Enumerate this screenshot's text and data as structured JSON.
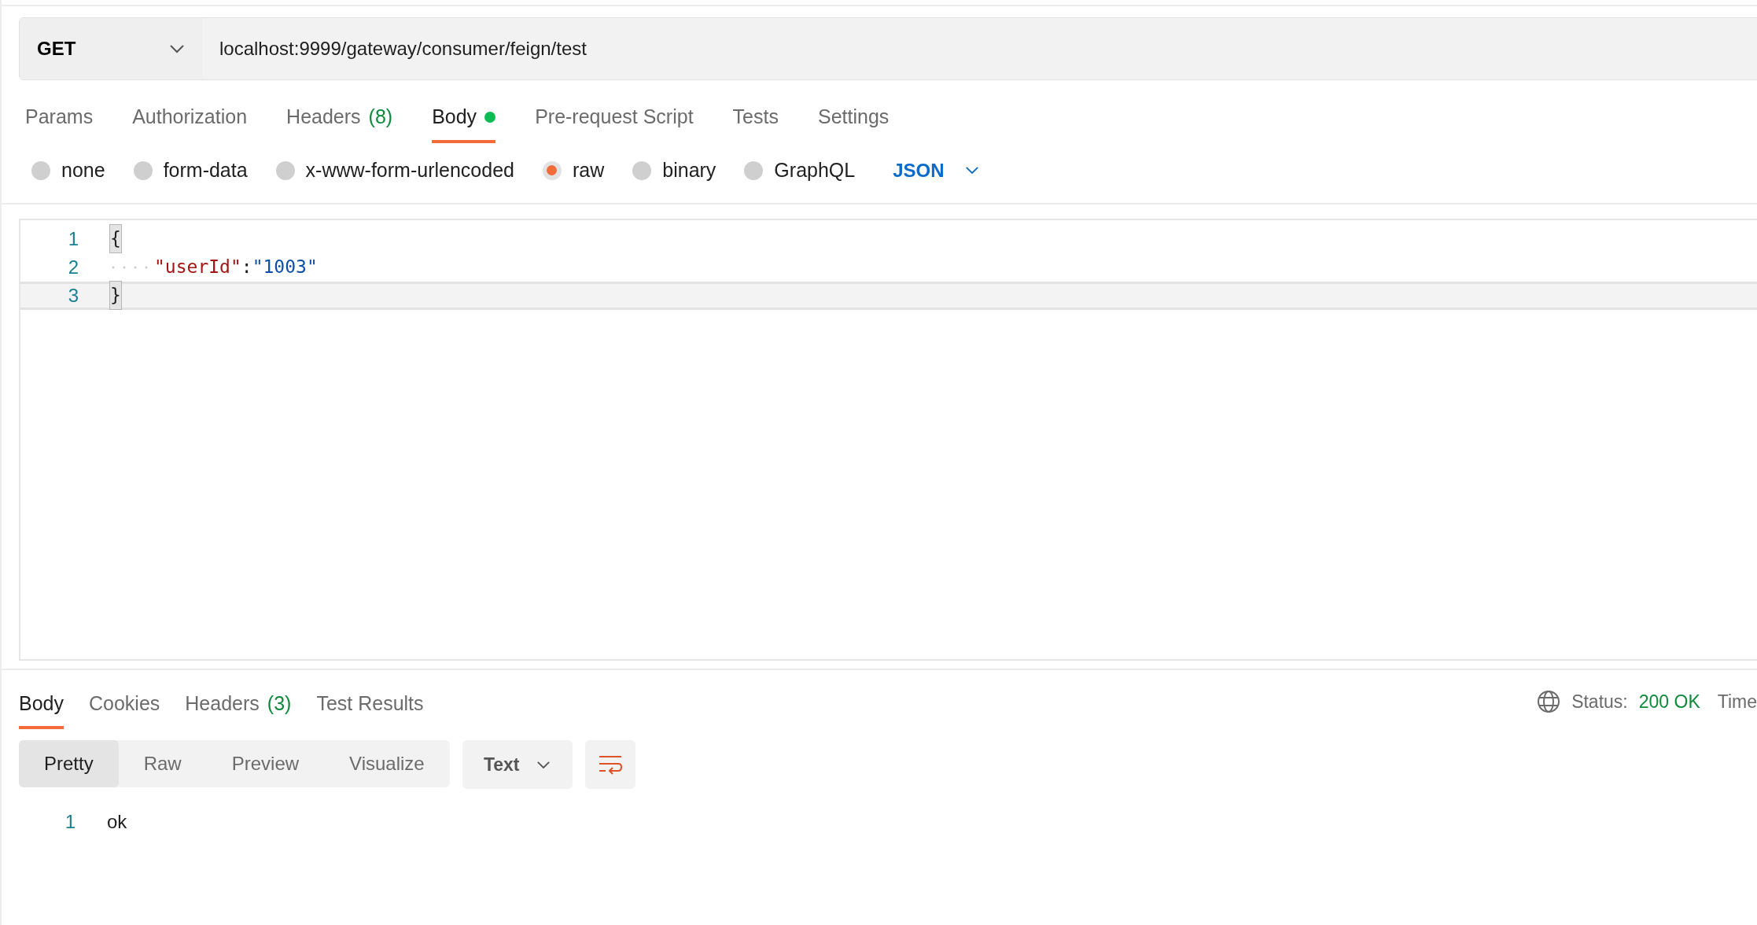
{
  "request": {
    "method": "GET",
    "url": "localhost:9999/gateway/consumer/feign/test"
  },
  "request_tabs": [
    {
      "label": "Params",
      "selected": false
    },
    {
      "label": "Authorization",
      "selected": false
    },
    {
      "label": "Headers",
      "count": "(8)",
      "selected": false
    },
    {
      "label": "Body",
      "selected": true,
      "indicator": true
    },
    {
      "label": "Pre-request Script",
      "selected": false
    },
    {
      "label": "Tests",
      "selected": false
    },
    {
      "label": "Settings",
      "selected": false
    }
  ],
  "body_types": [
    {
      "label": "none",
      "selected": false
    },
    {
      "label": "form-data",
      "selected": false
    },
    {
      "label": "x-www-form-urlencoded",
      "selected": false
    },
    {
      "label": "raw",
      "selected": true
    },
    {
      "label": "binary",
      "selected": false
    },
    {
      "label": "GraphQL",
      "selected": false
    }
  ],
  "body_format": "JSON",
  "editor": {
    "lines": [
      {
        "number": "1",
        "active": false,
        "tokens": [
          {
            "kind": "brace",
            "text": "{",
            "matched": true
          }
        ]
      },
      {
        "number": "2",
        "active": false,
        "tokens": [
          {
            "kind": "indent"
          },
          {
            "kind": "key",
            "text": "\"userId\""
          },
          {
            "kind": "punct",
            "text": ":"
          },
          {
            "kind": "string",
            "text": "\"1003\""
          }
        ]
      },
      {
        "number": "3",
        "active": true,
        "tokens": [
          {
            "kind": "brace",
            "text": "}",
            "matched": true
          }
        ]
      }
    ]
  },
  "response": {
    "tabs": [
      {
        "label": "Body",
        "selected": true
      },
      {
        "label": "Cookies",
        "selected": false
      },
      {
        "label": "Headers",
        "count": "(3)",
        "selected": false
      },
      {
        "label": "Test Results",
        "selected": false
      }
    ],
    "status_label": "Status:",
    "status_value": "200 OK",
    "time_label": "Time",
    "view_modes": [
      {
        "label": "Pretty",
        "selected": true
      },
      {
        "label": "Raw",
        "selected": false
      },
      {
        "label": "Preview",
        "selected": false
      },
      {
        "label": "Visualize",
        "selected": false
      }
    ],
    "format": "Text",
    "lines": [
      {
        "number": "1",
        "text": "ok"
      }
    ]
  }
}
